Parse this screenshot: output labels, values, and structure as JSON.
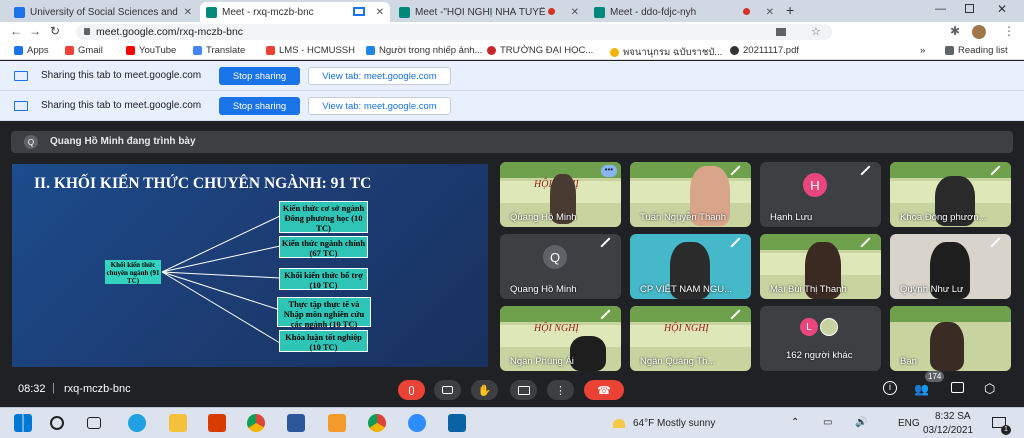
{
  "tabs": [
    {
      "label": "University of Social Sciences and",
      "color": "#1a73e8"
    },
    {
      "label": "Meet - rxq-mczb-bnc",
      "color": "#00897b"
    },
    {
      "label": "Meet -\"HỘI NGHỊ NHÀ TUYỂ",
      "color": "#00897b"
    },
    {
      "label": "Meet - ddo-fdjc-nyh",
      "color": "#00897b"
    }
  ],
  "toolbar": {
    "url": "meet.google.com/rxq-mczb-bnc"
  },
  "bookmarks": {
    "items": [
      "Apps",
      "Gmail",
      "YouTube",
      "Translate",
      "LMS - HCMUSSH",
      "Người trong nhiếp ảnh...",
      "TRƯỜNG ĐẠI HỌC...",
      "พจนานุกรม ฉบับราชบั...",
      "20211117.pdf"
    ],
    "more": "»",
    "reading_list": "Reading list"
  },
  "share_bars": [
    {
      "text": "Sharing this tab to meet.google.com",
      "stop_label": "Stop sharing",
      "view_label": "View tab: meet.google.com"
    },
    {
      "text": "Sharing this tab to meet.google.com",
      "stop_label": "Stop sharing",
      "view_label": "View tab: meet.google.com"
    }
  ],
  "presenting": {
    "initial": "Q",
    "label": "Quang Hồ Minh đang trình bày"
  },
  "slide": {
    "title": "II. KHỐI KIẾN THỨC CHUYÊN NGÀNH: 91 TC",
    "root": "Khối kiến thức chuyên ngành (91 TC)",
    "boxes": [
      "Kiến thức cơ sở ngành Đông phương học (10 TC)",
      "Kiến thức ngành chính (67 TC)",
      "Khối kiến thức bổ trợ (10 TC)",
      "Thực tập thực tế và Nhập môn nghiên cứu các ngành (10 TC)",
      "Khóa luận tốt nghiệp (10 TC)"
    ]
  },
  "participants": [
    {
      "name": "Quang Hồ Minh"
    },
    {
      "name": "Tuấn Nguyễn Thanh"
    },
    {
      "name": "Hạnh Lưu",
      "initial": "H",
      "color": "#e8467c"
    },
    {
      "name": "Khoa Đông phươn..."
    },
    {
      "name": "Quang Hồ Minh",
      "initial": "Q",
      "color": "#5f6368"
    },
    {
      "name": "CP VIỆT NAM NGU..."
    },
    {
      "name": "Mai Bùi Thị Thanh"
    },
    {
      "name": "Quỳnh Như Lư"
    },
    {
      "name": "Ngân Phùng Ái"
    },
    {
      "name": "Ngân Quảng Th..."
    },
    {
      "name": "162 người khác",
      "initial": "L",
      "color": "#e8467c"
    },
    {
      "name": "Bạn"
    }
  ],
  "slide_banner": {
    "hoi": "HỘI NGHỊ"
  },
  "meeting": {
    "time": "08:32",
    "code": "rxq-mczb-bnc",
    "people_count": "174"
  },
  "taskbar": {
    "weather": "64°F  Mostly sunny",
    "lang": "ENG",
    "time": "8:32 SA",
    "date": "03/12/2021",
    "badge": "1"
  }
}
